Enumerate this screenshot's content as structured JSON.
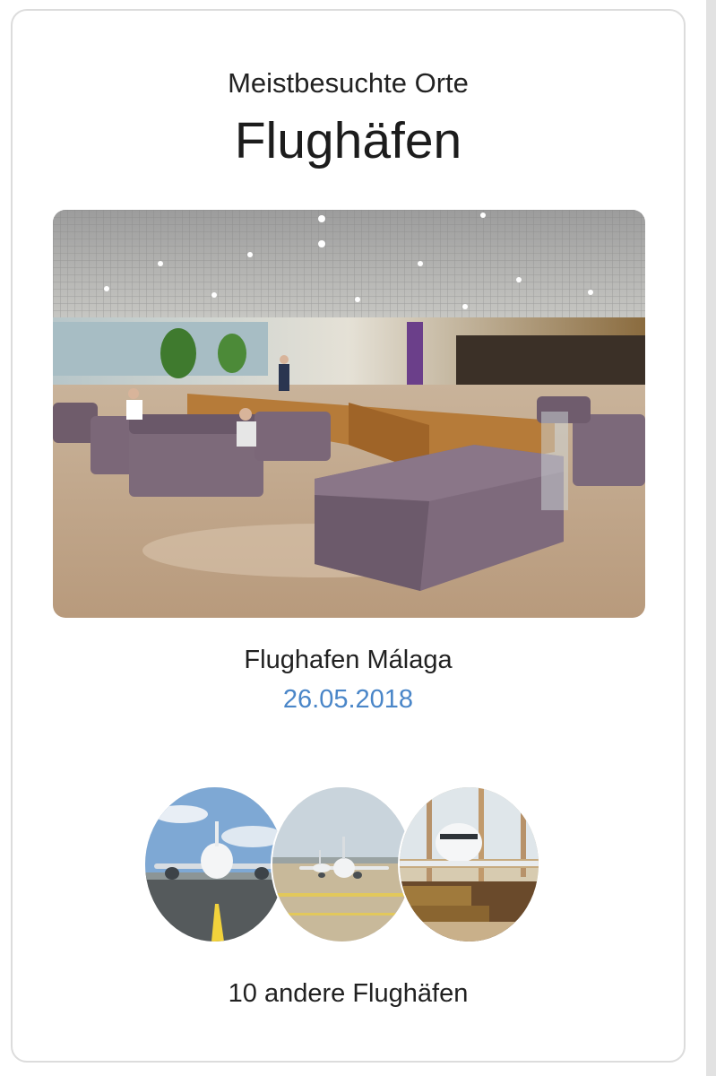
{
  "header": {
    "subtitle": "Meistbesuchte Orte",
    "title": "Flughäfen"
  },
  "featured": {
    "image_subject": "airport lounge with purple sofas",
    "name": "Flughafen Málaga",
    "date": "26.05.2018"
  },
  "others": {
    "thumbnails": [
      {
        "subject": "airplane on runway under blue sky"
      },
      {
        "subject": "airplane on tarmac"
      },
      {
        "subject": "airplane viewed from terminal window"
      }
    ],
    "label": "10 andere Flughäfen"
  },
  "colors": {
    "date_accent": "#4a86c8",
    "card_border": "#dcdcdc",
    "scrollbar": "#e2e2e2"
  }
}
